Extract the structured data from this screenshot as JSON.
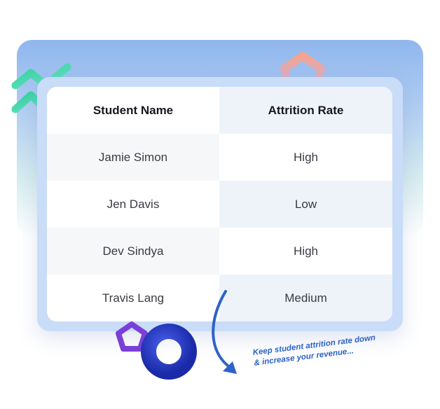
{
  "table": {
    "headers": {
      "name": "Student Name",
      "rate": "Attrition Rate"
    },
    "rows": [
      {
        "name": "Jamie Simon",
        "rate": "High"
      },
      {
        "name": "Jen Davis",
        "rate": "Low"
      },
      {
        "name": "Dev Sindya",
        "rate": "High"
      },
      {
        "name": "Travis Lang",
        "rate": "Medium"
      }
    ]
  },
  "caption": {
    "line1": "Keep student attrition rate down",
    "line2": "& increase your revenue..."
  },
  "colors": {
    "accent_blue": "#2d62c8",
    "chevron_green": "#3fd3a6",
    "pentagon_purple": "#7b3fd9",
    "torus_blue": "#1f3cc9"
  },
  "icons": [
    "double-chevron-icon",
    "hexagon-ring-icon",
    "pentagon-ring-icon",
    "torus-icon",
    "curved-arrow-icon"
  ]
}
